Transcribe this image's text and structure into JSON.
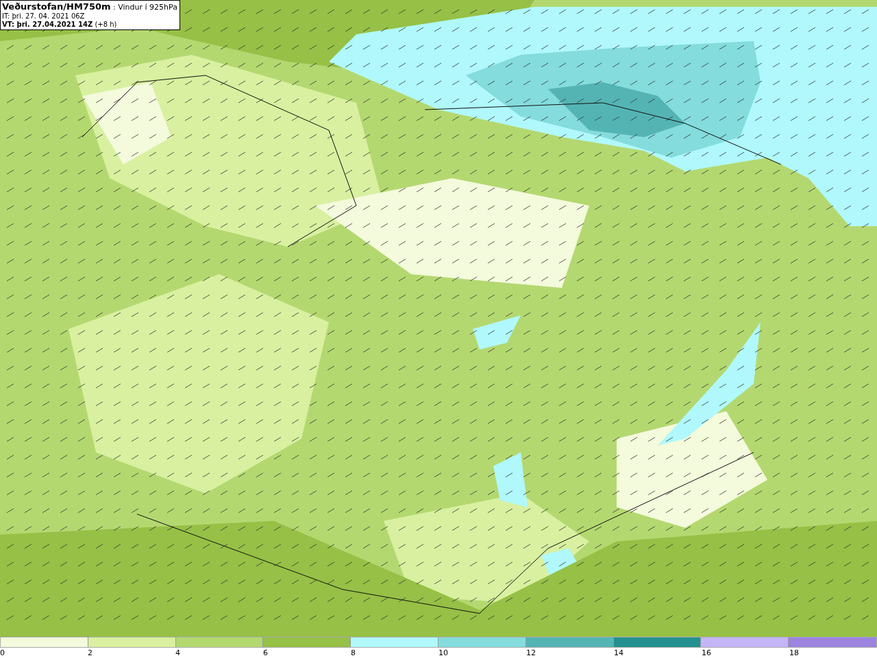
{
  "title_box": {
    "lines": [
      "**Veðurstofan/HM750m** : Vindur í 925hPa",
      "IT: þri. 27. 04. 2021 06Z",
      "**VT: þri. 27.04.2021 14Z** (+8 h)"
    ]
  },
  "legend": {
    "bins": [
      {
        "color": "#f4fadc"
      },
      {
        "color": "#d8f0a0"
      },
      {
        "color": "#b4d870"
      },
      {
        "color": "#96c046"
      },
      {
        "color": "#b0f8fc"
      },
      {
        "color": "#84dcdc"
      },
      {
        "color": "#54b4b4"
      },
      {
        "color": "#249090"
      },
      {
        "color": "#c4b4f8"
      },
      {
        "color": "#9c84e0"
      }
    ],
    "ticks": [
      "0",
      "2",
      "4",
      "6",
      "8",
      "10",
      "12",
      "14",
      "16",
      "18"
    ]
  }
}
